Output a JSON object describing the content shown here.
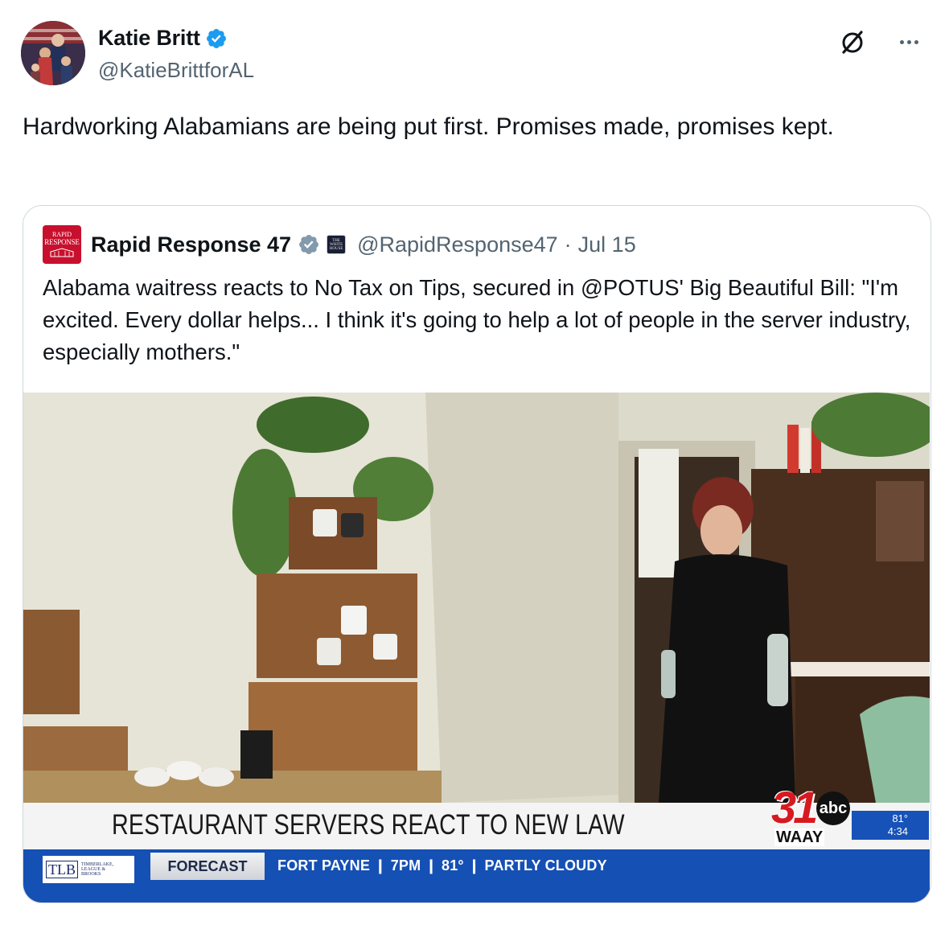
{
  "author": {
    "display_name": "Katie Britt",
    "handle": "@KatieBrittforAL",
    "verified_icon": "verified-badge-icon"
  },
  "actions": {
    "grok_icon": "grok-icon",
    "more_icon": "more-icon"
  },
  "tweet": {
    "text": "Hardworking Alabamians are being put first. Promises made, promises kept."
  },
  "quoted": {
    "avatar_line1": "RAPID",
    "avatar_line2": "RESPONSE",
    "display_name": "Rapid Response 47",
    "affiliation_line1": "THE",
    "affiliation_line2": "WHITE",
    "affiliation_line3": "HOUSE",
    "handle": "@RapidResponse47",
    "separator": "·",
    "date": "Jul 15",
    "text": "Alabama waitress reacts to No Tax on Tips, secured in @POTUS' Big Beautiful Bill: \"I'm excited. Every dollar helps... I think it's going to help a lot of people in the server industry, especially mothers.\"",
    "video": {
      "headline": "RESTAURANT SERVERS REACT TO NEW LAW",
      "station_number": "31",
      "network": "abc",
      "call_sign": "WAAY",
      "temp": "81°",
      "time": "4:34",
      "sponsor_mark": "TLB",
      "sponsor_name_1": "TIMBERLAKE,",
      "sponsor_name_2": "LEAGUE &",
      "sponsor_name_3": "BROOKS",
      "forecast_label": "FORECAST",
      "ticker": "FORT PAYNE  ❙  7PM  ❙  81°  ❙  PARTLY CLOUDY"
    }
  },
  "colors": {
    "text_primary": "#0f1419",
    "text_secondary": "#536471",
    "verified_blue": "#1d9bf0",
    "border": "#cfd9de",
    "ticker_blue": "#1550b4",
    "station_red": "#d71920"
  }
}
